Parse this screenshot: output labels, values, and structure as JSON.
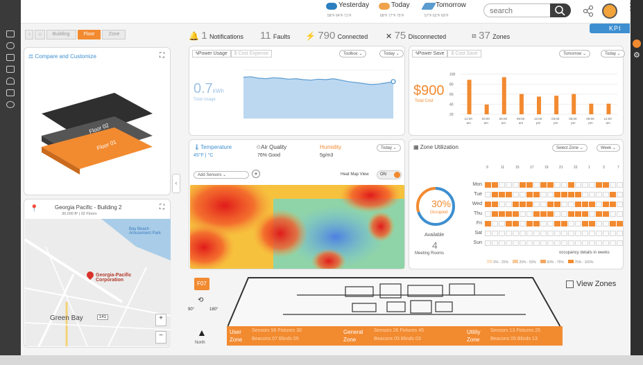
{
  "header": {
    "weather": [
      {
        "label": "Yesterday",
        "temps": "58°F  64°F  71°F"
      },
      {
        "label": "Today",
        "temps": "68°F  77°F  75°F"
      },
      {
        "label": "Tomorrow",
        "temps": "57°F  62°F  69°F"
      }
    ],
    "search_placeholder": "search"
  },
  "kpi_label": "KPI",
  "breadcrumb": [
    "Building",
    "Floor",
    "Zone"
  ],
  "summary": {
    "notifications_count": "1",
    "notifications_label": "Notifications",
    "faults_count": "11",
    "faults_label": "Faults",
    "connected_count": "790",
    "connected_label": "Connected",
    "disconnected_count": "75",
    "disconnected_label": "Disconnected",
    "zones_count": "37",
    "zones_label": "Zones"
  },
  "compare": {
    "title": "Compare and Customize",
    "floor_upper": "Floor 02",
    "floor_lower": "Floor 01"
  },
  "building": {
    "name": "Georgia Pacific - Building 2",
    "details": "30,000 ft² | 02 Floors"
  },
  "map": {
    "park": "Bay Beach Amusement Park",
    "marker": "Georgia-Pacific Corporation",
    "city": "Green Bay",
    "route": "141",
    "zoom_in": "+",
    "zoom_out": "−"
  },
  "power_usage": {
    "tab_active": "Power Usage",
    "tab_inactive": "Cost Expense",
    "filter_period": "Toolbox",
    "filter_day": "Today",
    "value": "0.7",
    "unit": "kWh",
    "sub_label": "Total Usage"
  },
  "power_save": {
    "tab_active": "Power Save",
    "tab_inactive": "Cost Save",
    "filter_period": "Tomorrow",
    "filter_day": "Today",
    "value": "$900",
    "sub_label": "Total Cost"
  },
  "chart_data": [
    {
      "type": "area",
      "title": "Power Usage",
      "x": [
        0,
        1,
        2,
        3,
        4,
        5,
        6,
        7,
        8,
        9,
        10,
        11,
        12,
        13,
        14,
        15,
        16,
        17,
        18,
        19,
        20
      ],
      "values": [
        0.85,
        0.86,
        0.83,
        0.82,
        0.84,
        0.83,
        0.81,
        0.82,
        0.8,
        0.79,
        0.81,
        0.8,
        0.82,
        0.79,
        0.76,
        0.74,
        0.72,
        0.7,
        0.71,
        0.73,
        0.76
      ],
      "ylim": [
        0,
        1
      ],
      "grid": true
    },
    {
      "type": "bar",
      "title": "Power Save",
      "categories": [
        "12:00 am",
        "03:00 am",
        "06:00 am",
        "09:00 am",
        "12:00 pm",
        "03:00 pm",
        "06:00 pm",
        "09:00 pm",
        "12:00 am"
      ],
      "values": [
        78,
        22,
        84,
        46,
        40,
        42,
        46,
        24,
        24
      ],
      "y_ticks": [
        "100",
        "80",
        "60",
        "40",
        "20"
      ],
      "ylim": [
        0,
        100
      ],
      "grid": true
    }
  ],
  "environment": {
    "temp_label": "Temperature",
    "temp_value": "45°F | °C",
    "air_label": "Air Quality",
    "air_value": "76% Good",
    "humidity_label": "Humidity",
    "humidity_value": "5g/m3",
    "filter_day": "Today",
    "add_sensors": "Add Sensors",
    "heatmap_toggle_label": "Heat Map View",
    "heatmap_toggle_state": "ON"
  },
  "zone_util": {
    "title": "Zone Utilization",
    "filter_zone": "Select Zone",
    "filter_week": "Week",
    "percent": "30%",
    "percent_label": "Occupied",
    "available_label": "Available",
    "available_count": "4",
    "available_sub": "Meeting Rooms",
    "days": [
      "Mon",
      "Tue",
      "Wed",
      "Thu",
      "Fri",
      "Sat",
      "Sun"
    ],
    "hour_labels": [
      "9",
      "11",
      "15",
      "17",
      "19",
      "21",
      "22",
      "1",
      "3",
      "7"
    ],
    "footer_note": "occupancy details in weeks",
    "legend": [
      "0% - 25%",
      "25% - 50%",
      "50% - 75%",
      "75% - 100%"
    ]
  },
  "floorplan": {
    "floor_code": "F07",
    "rotate_left": "90°",
    "rotate_right": "180°",
    "north_label": "North",
    "view_zones_label": "View Zones",
    "zones": [
      {
        "title": "User Zone",
        "line1": "Sensors 56  Fixtures 30",
        "line2": "Beacons 07  Blinds 05"
      },
      {
        "title": "General Zone",
        "line1": "Sensors 26  Fixtures 45",
        "line2": "Beacons 05  Blinds 03"
      },
      {
        "title": "Utility Zone",
        "line1": "Sensors 13  Fixtures 25",
        "line2": "Beacons 05  Blinds 13"
      }
    ]
  },
  "colors": {
    "accent": "#f28a30",
    "blue": "#9ec0e4",
    "dark": "#3a3a3a"
  }
}
